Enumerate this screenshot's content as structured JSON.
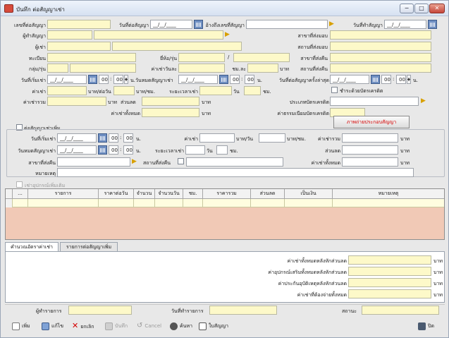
{
  "window": {
    "title": "บันทึก ต่อสัญญาเช่า",
    "min": "−",
    "max": "□",
    "close": "✕"
  },
  "row1": {
    "contract_no_label": "เลขที่ต่อสัญญา",
    "contract_date_label": "วันที่ต่อสัญญา",
    "contract_date_value": "__/__/____",
    "ref_label": "อ้างถึงเลขที่สัญญา",
    "made_date_label": "วันที่ทำสัญญา",
    "made_date_value": "__/__/____"
  },
  "row2": {
    "maker_label": "ผู้ทำสัญญา",
    "send_branch_label": "สาขาที่ส่งมอบ"
  },
  "row3": {
    "renter_label": "ผู้เช่า",
    "send_place_label": "สถานที่ส่งมอบ"
  },
  "row4": {
    "reg_label": "ทะเบียน",
    "brand_label": "ยี่ห้อ/รุ่น",
    "slash": "/",
    "return_branch_label": "สาขาที่ส่งคืน"
  },
  "row5": {
    "group_label": "กลุ่ม/รุ่น",
    "daily_rate_label": "ค่าเช่าวันละ",
    "hour_label": "ชม.ละ",
    "baht": "บาท",
    "return_place_label": "สถานที่ส่งคืน"
  },
  "row6": {
    "start_label": "วันที่เริ่มเช่า",
    "start_value": "__/__/____",
    "hh": "00",
    "mm": "00",
    "time_unit": "น.",
    "end_label": "น.วันหมดสัญญาเช่า",
    "end_value": "__/__/____",
    "last_label": "วันที่ต่อสัญญาครั้งล่าสุด",
    "last_value": "__/__/____",
    "colon": ":"
  },
  "row7": {
    "rent_label": "ค่าเช่า",
    "per_day": "บาท/ต่อวัน",
    "per_hour": "บาท/ชม.",
    "period_label": "ระยะเวลาเช่า",
    "day": "วัน",
    "hour": "ชม.",
    "credit_label": "ชำระด้วยบัตรเครดิต"
  },
  "row8": {
    "total_label": "ค่าเช่ารวม",
    "baht": "บาท",
    "discount_label": "ส่วนลด",
    "baht2": "บาท",
    "card_type_label": "ประเภทบัตรเครดิต"
  },
  "row9": {
    "all_label": "ค่าเช่าทั้งหมด",
    "baht": "บาท",
    "card_fee_label": "ค่าธรรมเนียมบัตรเครดิต"
  },
  "red_button": "ภาพถ่ายประกอบสัญญา",
  "extra": {
    "check_label": "ต่อสัญญาเช่าเพิ่ม",
    "start_label": "วันที่เริ่มเช่า",
    "start_value": "__/__/____",
    "hh": "00",
    "mm": "00",
    "unit": "น.",
    "rent_label": "ค่าเช่า",
    "per_day": "บาท/วัน",
    "per_hour": "บาท/ชม.",
    "total_label": "ค่าเช่ารวม",
    "baht": "บาท",
    "end_label": "วันหมดสัญญาเช่า",
    "end_value": "__/__/____",
    "period_label": "ระยะเวลาเช่า",
    "day": "วัน",
    "hour": "ชม.",
    "discount_label": "ส่วนลด",
    "return_branch_label": "สาขาที่ส่งคืน",
    "return_place_label": "สถานที่ส่งคืน",
    "all_label": "ค่าเช่าทั้งหมด",
    "note_label": "หมายเหตุ"
  },
  "equipment_label": "เช่าอุปกรณ์เพิ่มเติม",
  "grid": {
    "columns": [
      "...",
      "รายการ",
      "ราคาต่อวัน",
      "จำนวน",
      "จำนวนวัน",
      "ชม.",
      "ราคารวม",
      "ส่วนลด",
      "เป็นเงิน",
      "หมายเหตุ"
    ]
  },
  "tabs": [
    "คำนวณอัตราค่าเช่า",
    "รายการต่อสัญญาเพิ่ม"
  ],
  "calc": {
    "rows": [
      "ค่าเช่าทั้งหมดหลังหักส่วนลด",
      "ค่าอุปกรณ์เสริมทั้งหมดหลังหักส่วนลด",
      "ค่าประกันอุบัติเหตุหลังหักส่วนลด",
      "ค่าเช่าที่ต้องจ่ายทั้งหมด"
    ],
    "unit": "บาท"
  },
  "footer": {
    "by_label": "ผู้ทำรายการ",
    "date_label": "วันที่ทำรายการ",
    "status_label": "สถานะ"
  },
  "toolbar": {
    "add": "เพิ่ม",
    "edit": "แก้ไข",
    "cancel_doc": "ยกเลิก",
    "save": "บันทึก",
    "cancel": "Cancel",
    "search": "ค้นหา",
    "print": "ใบสัญญา",
    "close": "ปิด"
  }
}
